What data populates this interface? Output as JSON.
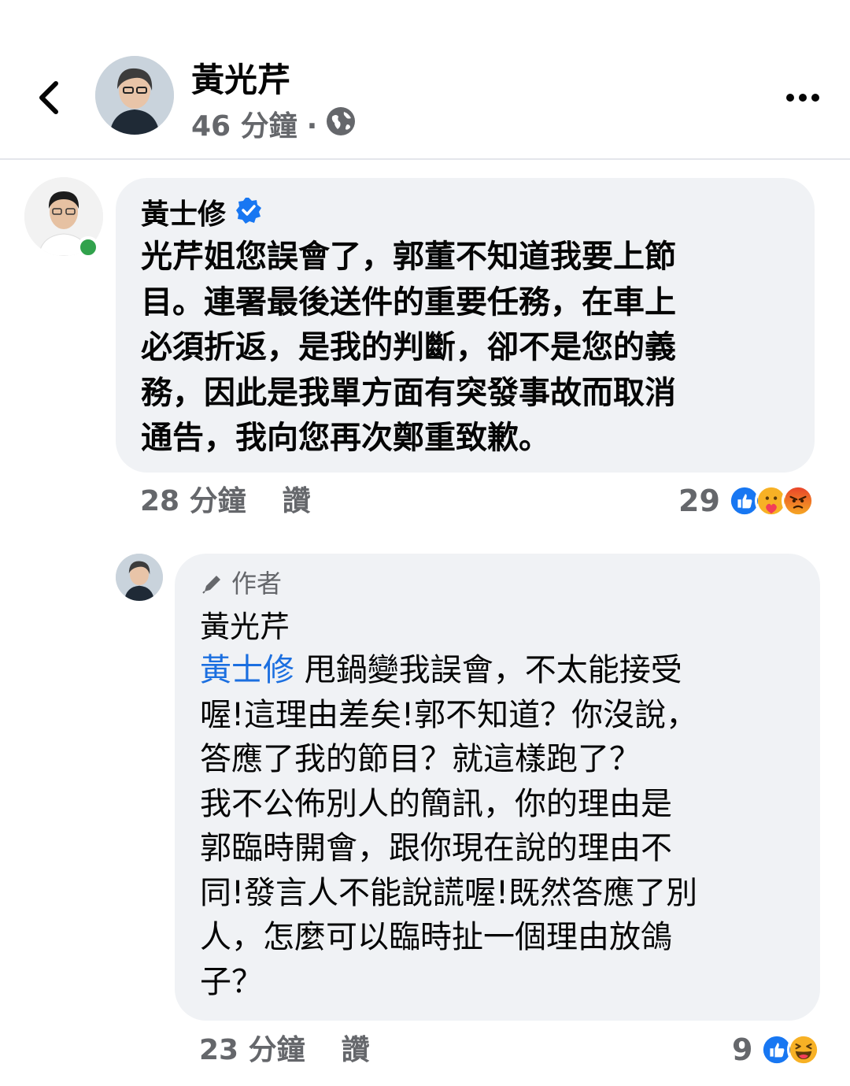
{
  "post": {
    "author": "黃光芹",
    "time": "46 分鐘",
    "separator": "·",
    "icons": {
      "back": "chevron-left-icon",
      "privacy": "globe-icon",
      "more": "more-dots-icon"
    }
  },
  "comments": [
    {
      "author": "黃士修",
      "verified": true,
      "online": true,
      "text": "光芹姐您誤會了，郭董不知道我要上節\n目。連署最後送件的重要任務，在車上\n必須折返，是我的判斷，卻不是您的義\n務，因此是我單方面有突發事故而取消\n通告，我向您再次鄭重致歉。",
      "time": "28 分鐘",
      "like_label": "讚",
      "reaction_count": "29",
      "reactions": [
        "like",
        "care",
        "angry"
      ]
    },
    {
      "author_tag": "作者",
      "author": "黃光芹",
      "mention": "黃士修",
      "text": " 甩鍋變我誤會，不太能接受\n喔!這理由差矣!郭不知道？你沒說，\n答應了我的節目？就這樣跑了？\n我不公佈別人的簡訊，你的理由是\n郭臨時開會，跟你現在說的理由不\n同!發言人不能說謊喔!既然答應了別\n人，怎麼可以臨時扯一個理由放鴿\n子？",
      "time": "23 分鐘",
      "like_label": "讚",
      "reaction_count": "9",
      "reactions": [
        "like",
        "haha"
      ]
    }
  ],
  "colors": {
    "like": "#1877f2",
    "online": "#31a24c",
    "mention": "#1b6fe0",
    "angry": "#e9710f",
    "care": "#f7b125",
    "bubble": "#f0f2f5"
  }
}
